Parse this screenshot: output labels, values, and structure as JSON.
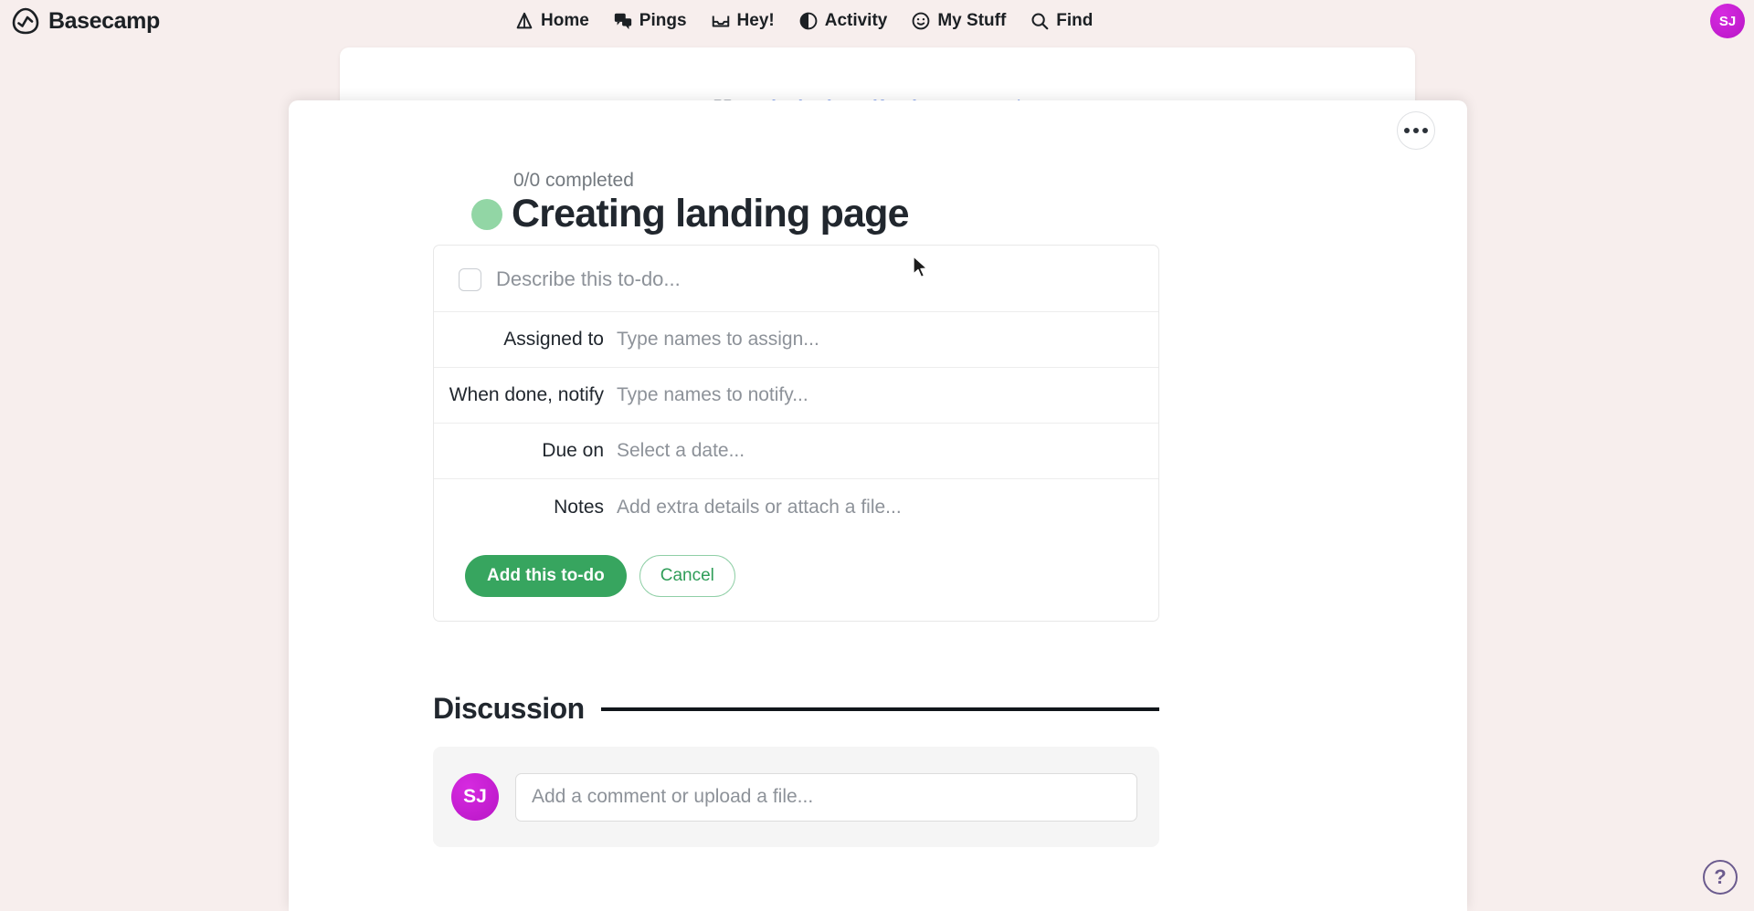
{
  "app": {
    "brand_name": "Basecamp",
    "brand_logo_icon": "basecamp-logo-icon"
  },
  "nav": {
    "items": [
      {
        "label": "Home",
        "icon": "home-icon"
      },
      {
        "label": "Pings",
        "icon": "chat-bubbles-icon"
      },
      {
        "label": "Hey!",
        "icon": "inbox-tray-icon"
      },
      {
        "label": "Activity",
        "icon": "pie-chart-icon"
      },
      {
        "label": "My Stuff",
        "icon": "smiley-face-icon"
      },
      {
        "label": "Find",
        "icon": "search-icon"
      }
    ],
    "account_avatar_initials": "SJ"
  },
  "breadcrumb": {
    "grid_icon": "grid-icon",
    "project": "Redesigning uifeed.com",
    "separator": "›",
    "section": "To-dos"
  },
  "modal": {
    "menu_icon": "ellipsis-icon",
    "completed_label": "0/0 completed",
    "title": "Creating landing page",
    "bullet_color": "#92d6a5"
  },
  "todo_form": {
    "describe_placeholder": "Describe this to-do...",
    "rows": [
      {
        "label": "Assigned to",
        "placeholder": "Type names to assign..."
      },
      {
        "label": "When done, notify",
        "placeholder": "Type names to notify..."
      },
      {
        "label": "Due on",
        "placeholder": "Select a date..."
      },
      {
        "label": "Notes",
        "placeholder": "Add extra details or attach a file..."
      }
    ],
    "submit_label": "Add this to-do",
    "cancel_label": "Cancel",
    "submit_color": "#37a55f"
  },
  "discussion": {
    "title": "Discussion",
    "comment_avatar_initials": "SJ",
    "comment_placeholder": "Add a comment or upload a file..."
  },
  "help": {
    "label": "?"
  }
}
